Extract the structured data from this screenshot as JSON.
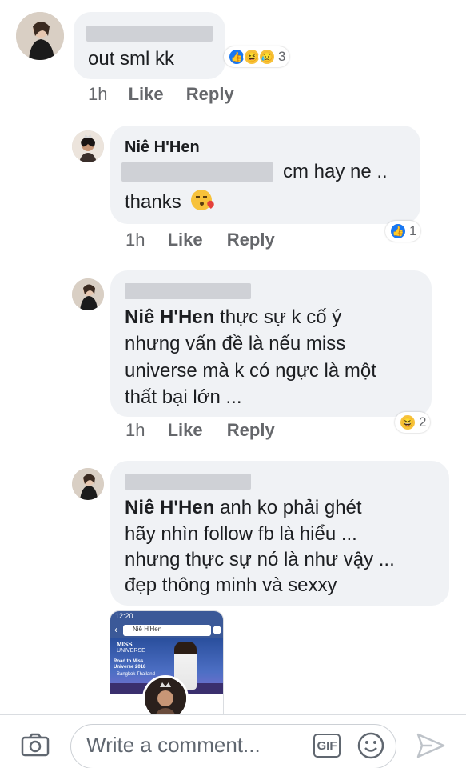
{
  "comments": [
    {
      "text": "out sml kk",
      "time": "1h",
      "like_label": "Like",
      "reply_label": "Reply",
      "reaction_count": "3",
      "reaction_icons": [
        "like-icon",
        "haha-icon",
        "sad-icon"
      ]
    },
    {
      "author": "Niê H'Hen",
      "text_line1": "cm hay ne ..",
      "text_line2": "thanks",
      "emoji": "kissing-face-icon",
      "time": "1h",
      "like_label": "Like",
      "reply_label": "Reply",
      "reaction_count": "1",
      "reaction_icons": [
        "like-icon"
      ]
    },
    {
      "mention": "Niê H'Hen",
      "text_line1": " thực sự k cố ý",
      "text_line2": "nhưng vấn đề là nếu miss",
      "text_line3": "universe mà k có ngực là một",
      "text_line4": "thất bại lớn ...",
      "time": "1h",
      "like_label": "Like",
      "reply_label": "Reply",
      "reaction_count": "2",
      "reaction_icons": [
        "haha-icon"
      ]
    },
    {
      "mention": "Niê H'Hen",
      "text_line1": " anh ko phải ghét",
      "text_line2": "hãy nhìn follow fb là hiểu ...",
      "text_line3": "nhưng thực sự nó là như vậy ...",
      "text_line4": "đẹp thông minh và sexxy",
      "attachment": {
        "status_time": "12:20",
        "search_text": "Niê H'Hen",
        "brand_line1": "MISS",
        "brand_line2": "UNIVERSE",
        "headline1": "Road to Miss Universe 2018",
        "headline2": "Bangkok Thailand"
      }
    }
  ],
  "composer": {
    "placeholder": "Write a comment...",
    "gif_label": "GIF",
    "icons": [
      "camera-icon",
      "gif-icon",
      "emoji-icon",
      "send-icon"
    ]
  },
  "colors": {
    "bubble": "#f0f2f5",
    "like_blue": "#1877f2",
    "haha_yellow": "#f7c23b",
    "meta_gray": "#65676b"
  }
}
